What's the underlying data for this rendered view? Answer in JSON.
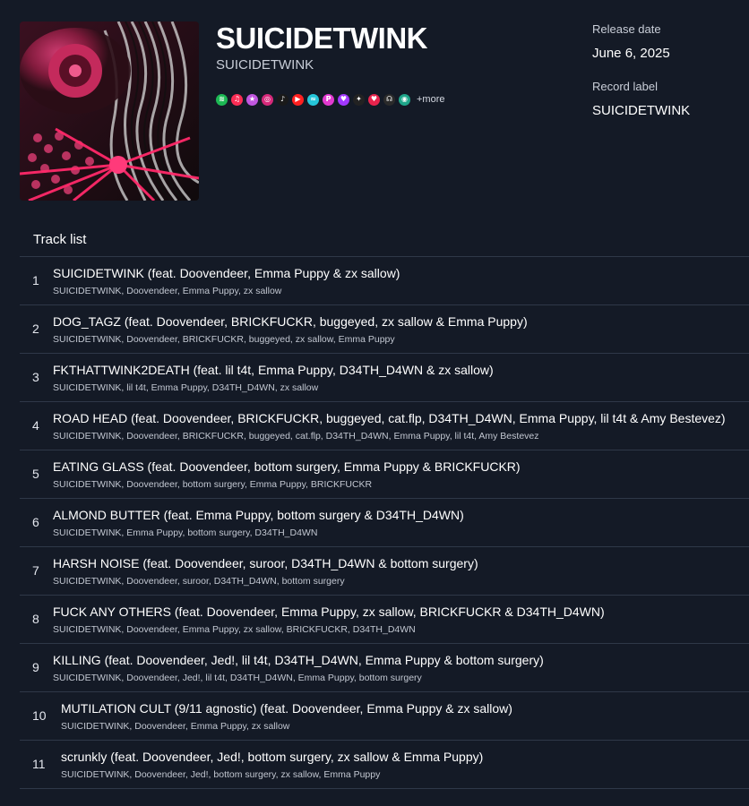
{
  "release": {
    "title": "SUICIDETWINK",
    "artist": "SUICIDETWINK",
    "release_date_label": "Release date",
    "release_date": "June 6, 2025",
    "record_label_label": "Record label",
    "record_label": "SUICIDETWINK"
  },
  "platforms": {
    "icons": [
      {
        "name": "spotify-icon",
        "color": "#1db954",
        "glyph": "≋"
      },
      {
        "name": "apple-music-icon",
        "color": "#fa2d55",
        "glyph": "♫"
      },
      {
        "name": "itunes-icon",
        "color": "#c157e0",
        "glyph": "★"
      },
      {
        "name": "instagram-icon",
        "color": "#d6297a",
        "glyph": "◎"
      },
      {
        "name": "tiktok-icon",
        "color": "#1a1a1a",
        "glyph": "♪"
      },
      {
        "name": "youtube-music-icon",
        "color": "#ff2020",
        "glyph": "▶"
      },
      {
        "name": "amazon-music-icon",
        "color": "#25c6d9",
        "glyph": "≈"
      },
      {
        "name": "pandora-icon",
        "color": "#e23ad0",
        "glyph": "P"
      },
      {
        "name": "deezer-icon",
        "color": "#a238ff",
        "glyph": "♥"
      },
      {
        "name": "tidal-icon",
        "color": "#222222",
        "glyph": "✦"
      },
      {
        "name": "iheartradio-icon",
        "color": "#e8234c",
        "glyph": "♥"
      },
      {
        "name": "napster-icon",
        "color": "#2a2a2a",
        "glyph": "☊"
      },
      {
        "name": "audiomack-icon",
        "color": "#1fa68a",
        "glyph": "◉"
      }
    ],
    "more_label": "+more"
  },
  "tracklist": {
    "heading": "Track list",
    "tracks": [
      {
        "num": "1",
        "title": "SUICIDETWINK (feat. Doovendeer, Emma Puppy & zx sallow)",
        "artists": "SUICIDETWINK, Doovendeer, Emma Puppy, zx sallow"
      },
      {
        "num": "2",
        "title": "DOG_TAGZ (feat. Doovendeer, BRICKFUCKR, buggeyed, zx sallow & Emma Puppy)",
        "artists": "SUICIDETWINK, Doovendeer, BRICKFUCKR, buggeyed, zx sallow, Emma Puppy"
      },
      {
        "num": "3",
        "title": "FKTHATTWINK2DEATH (feat. lil t4t, Emma Puppy, D34TH_D4WN & zx sallow)",
        "artists": "SUICIDETWINK, lil t4t, Emma Puppy, D34TH_D4WN, zx sallow"
      },
      {
        "num": "4",
        "title": "ROAD HEAD (feat. Doovendeer, BRICKFUCKR, buggeyed, cat.flp, D34TH_D4WN, Emma Puppy, lil t4t & Amy Bestevez)",
        "artists": "SUICIDETWINK, Doovendeer, BRICKFUCKR, buggeyed, cat.flp, D34TH_D4WN, Emma Puppy, lil t4t, Amy Bestevez"
      },
      {
        "num": "5",
        "title": "EATING GLASS (feat. Doovendeer, bottom surgery, Emma Puppy & BRICKFUCKR)",
        "artists": "SUICIDETWINK, Doovendeer, bottom surgery, Emma Puppy, BRICKFUCKR"
      },
      {
        "num": "6",
        "title": "ALMOND BUTTER (feat. Emma Puppy, bottom surgery & D34TH_D4WN)",
        "artists": "SUICIDETWINK, Emma Puppy, bottom surgery, D34TH_D4WN"
      },
      {
        "num": "7",
        "title": "HARSH NOISE (feat. Doovendeer, suroor, D34TH_D4WN & bottom surgery)",
        "artists": "SUICIDETWINK, Doovendeer, suroor, D34TH_D4WN, bottom surgery"
      },
      {
        "num": "8",
        "title": "FUCK ANY OTHERS (feat. Doovendeer, Emma Puppy, zx sallow, BRICKFUCKR & D34TH_D4WN)",
        "artists": "SUICIDETWINK, Doovendeer, Emma Puppy, zx sallow, BRICKFUCKR, D34TH_D4WN"
      },
      {
        "num": "9",
        "title": "KILLING (feat. Doovendeer, Jed!, lil t4t, D34TH_D4WN, Emma Puppy & bottom surgery)",
        "artists": "SUICIDETWINK, Doovendeer, Jed!, lil t4t, D34TH_D4WN, Emma Puppy, bottom surgery"
      },
      {
        "num": "10",
        "title": "MUTILATION CULT (9/11 agnostic) (feat. Doovendeer, Emma Puppy & zx sallow)",
        "artists": "SUICIDETWINK, Doovendeer, Emma Puppy, zx sallow"
      },
      {
        "num": "11",
        "title": "scrunkly (feat. Doovendeer, Jed!, bottom surgery, zx sallow & Emma Puppy)",
        "artists": "SUICIDETWINK, Doovendeer, Jed!, bottom surgery, zx sallow, Emma Puppy"
      }
    ]
  }
}
